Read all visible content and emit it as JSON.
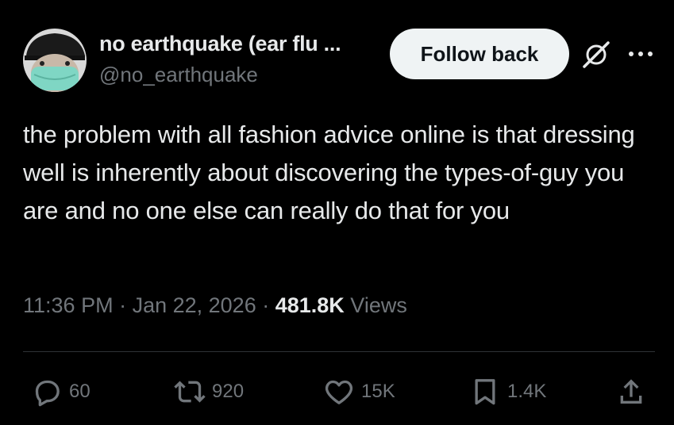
{
  "author": {
    "display_name": "no earthquake (ear flu ...",
    "handle": "@no_earthquake",
    "avatar_icon": "masked-person-avatar"
  },
  "header": {
    "follow_label": "Follow back",
    "grok_icon": "slash-circle-icon",
    "more_icon": "more-dots-icon"
  },
  "tweet": {
    "text": "the problem with all fashion advice online is that dressing well is inherently about discovering the types-of-guy you are and no one else can really do that for you",
    "time": "11:36 PM",
    "separator": " · ",
    "date": "Jan 22, 2026",
    "views_count": "481.8K",
    "views_label": " Views"
  },
  "actions": {
    "replies": "60",
    "reposts": "920",
    "likes": "15K",
    "bookmarks": "1.4K"
  },
  "colors": {
    "background": "#000000",
    "text": "#e7e9ea",
    "muted": "#71767b",
    "divider": "#2f3336",
    "button_bg": "#eff3f4"
  }
}
